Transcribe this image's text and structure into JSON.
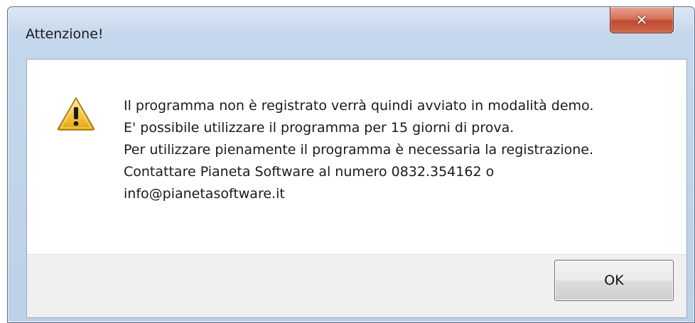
{
  "window": {
    "title": "Attenzione!",
    "close_icon": "close-icon"
  },
  "dialog": {
    "icon": "warning-icon",
    "message_lines": [
      "Il programma non è registrato verrà quindi avviato in modalità demo.",
      "E' possibile utilizzare il programma per 15 giorni di prova.",
      "Per utilizzare pienamente il programma è necessaria la registrazione.",
      "Contattare Pianeta Software al numero 0832.354162 o",
      "info@pianetasoftware.it"
    ],
    "ok_label": "OK"
  },
  "colors": {
    "close_button": "#c94f34",
    "title_bar": "#c5d7ec",
    "warning_fill": "#f3c23a"
  }
}
